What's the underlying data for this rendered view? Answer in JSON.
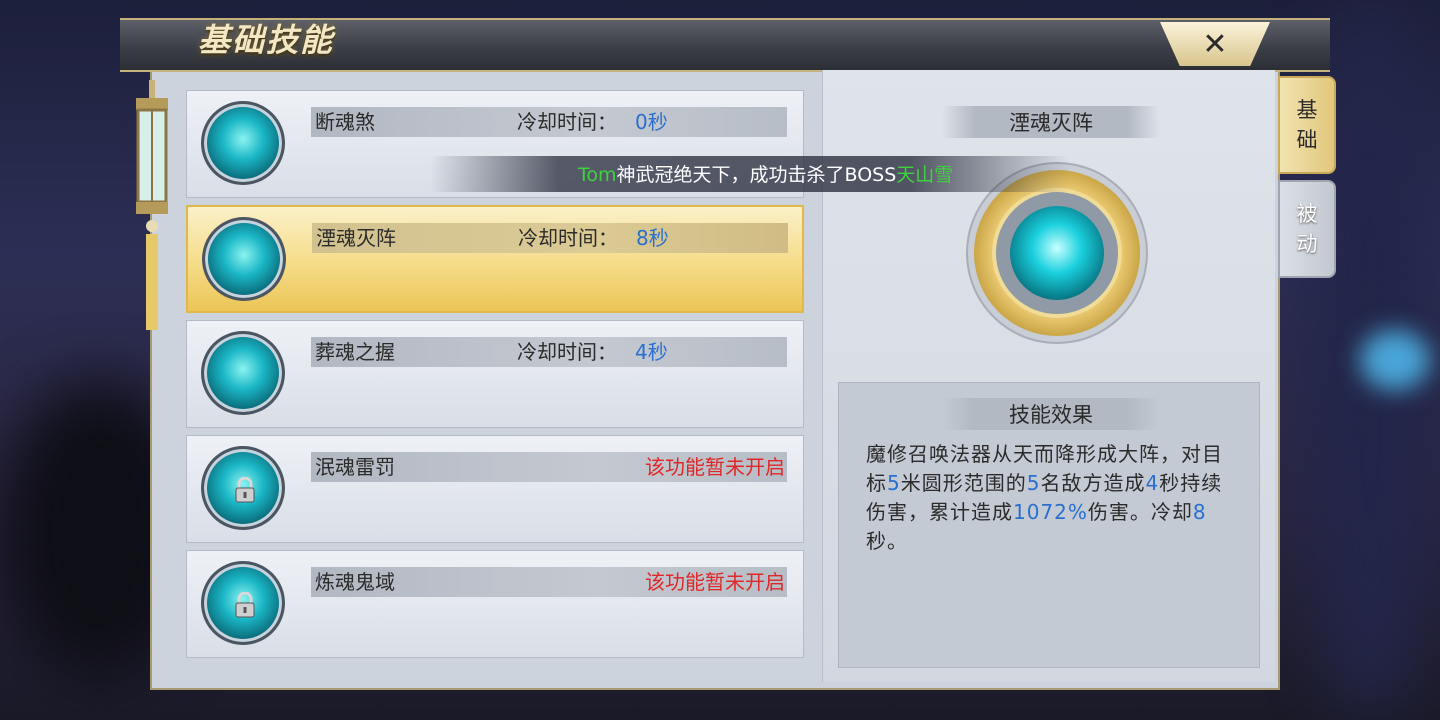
{
  "window": {
    "title": "基础技能",
    "close_label": "✕"
  },
  "tabs": [
    {
      "label": "基础",
      "active": true
    },
    {
      "label": "被动",
      "active": false
    }
  ],
  "skills": [
    {
      "name": "断魂煞",
      "cooldown_label": "冷却时间：",
      "cooldown_value": "0秒",
      "locked": false,
      "icon": "skill-icon-dark-slash"
    },
    {
      "name": "湮魂灭阵",
      "cooldown_label": "冷却时间：",
      "cooldown_value": "8秒",
      "locked": false,
      "selected": true,
      "icon": "skill-icon-light-pillar"
    },
    {
      "name": "葬魂之握",
      "cooldown_label": "冷却时间：",
      "cooldown_value": "4秒",
      "locked": false,
      "icon": "skill-icon-grasp"
    },
    {
      "name": "泯魂雷罚",
      "locked_text": "该功能暂未开启",
      "locked": true,
      "icon": "skill-icon-thunder"
    },
    {
      "name": "炼魂鬼域",
      "locked_text": "该功能暂未开启",
      "locked": true,
      "icon": "skill-icon-ghost"
    }
  ],
  "announcement": {
    "player": "Tom",
    "text": "神武冠绝天下，成功击杀了BOSS",
    "boss": "天山雪"
  },
  "detail": {
    "skill_name": "湮魂灭阵",
    "effect_title": "技能效果",
    "effect_parts": [
      {
        "t": "魔修召唤法器从天而降形成大阵，对目标",
        "hl": false
      },
      {
        "t": "5",
        "hl": true
      },
      {
        "t": "米圆形范围的",
        "hl": false
      },
      {
        "t": "5",
        "hl": true
      },
      {
        "t": "名敌方造成",
        "hl": false
      },
      {
        "t": "4",
        "hl": true
      },
      {
        "t": "秒持续伤害，累计造成",
        "hl": false
      },
      {
        "t": "1072%",
        "hl": true
      },
      {
        "t": "伤害。冷却",
        "hl": false
      },
      {
        "t": "8",
        "hl": true
      },
      {
        "t": "秒。",
        "hl": false
      }
    ]
  },
  "colors": {
    "highlight_blue": "#2a6fd0",
    "locked_red": "#e02828",
    "announce_green": "#3fd23f",
    "gold_accent": "#e3b84a"
  }
}
